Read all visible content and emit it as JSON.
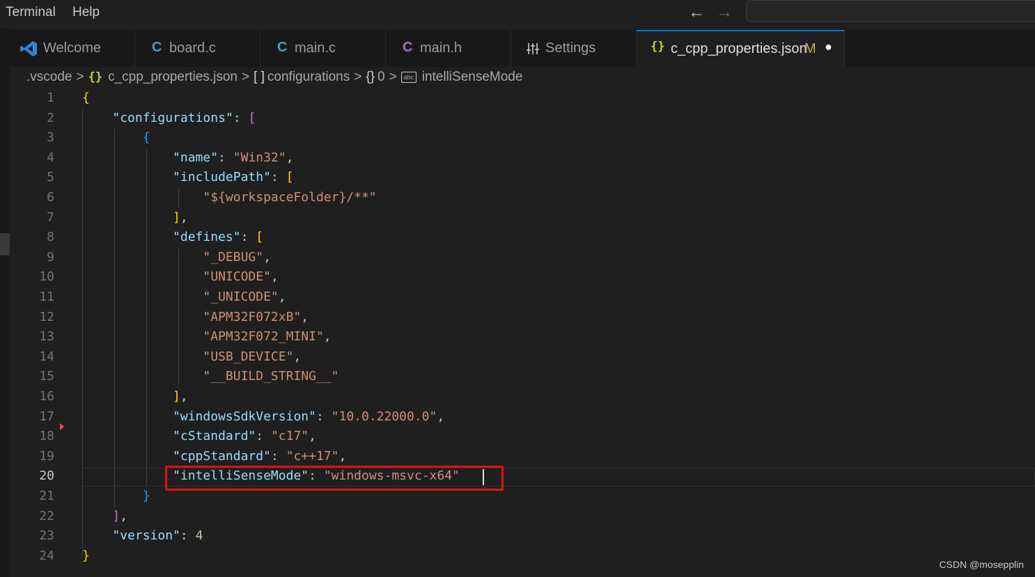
{
  "menu": {
    "terminal": "Terminal",
    "help": "Help"
  },
  "nav": {
    "back": "←",
    "forward": "→"
  },
  "tabs": [
    {
      "icon": "vscode-icon",
      "glyph": "",
      "label": "Welcome",
      "color": "#2f87d8"
    },
    {
      "icon": "c-file-icon",
      "glyph": "C",
      "label": "board.c",
      "color": "#519aba"
    },
    {
      "icon": "c-file-icon",
      "glyph": "C",
      "label": "main.c",
      "color": "#519aba"
    },
    {
      "icon": "h-file-icon",
      "glyph": "C",
      "label": "main.h",
      "color": "#a074c4"
    },
    {
      "icon": "settings-icon",
      "glyph": "",
      "label": "Settings",
      "color": "#cccccc"
    },
    {
      "icon": "json-icon",
      "glyph": "{}",
      "label": "c_cpp_properties.json",
      "modified": "M",
      "dirty": "●",
      "color": "#cbcb41"
    }
  ],
  "breadcrumb": {
    "folder": ".vscode",
    "file_icon": "{}",
    "file": "c_cpp_properties.json",
    "array_icon": "[ ]",
    "array": "configurations",
    "object_icon": "{}",
    "index": "0",
    "leaf_icon": "abc",
    "leaf": "intelliSenseMode",
    "sep": ">"
  },
  "editor": {
    "current_line": 20,
    "line_numbers": [
      "1",
      "2",
      "3",
      "4",
      "5",
      "6",
      "7",
      "8",
      "9",
      "10",
      "11",
      "12",
      "13",
      "14",
      "15",
      "16",
      "17",
      "18",
      "19",
      "20",
      "21",
      "22",
      "23",
      "24"
    ],
    "lines": [
      [
        [
          "b1",
          "{"
        ]
      ],
      [
        [
          "p",
          "    "
        ],
        [
          "k",
          "\"configurations\""
        ],
        [
          "p",
          ": "
        ],
        [
          "b2",
          "["
        ]
      ],
      [
        [
          "p",
          "        "
        ],
        [
          "b3",
          "{"
        ]
      ],
      [
        [
          "p",
          "            "
        ],
        [
          "k",
          "\"name\""
        ],
        [
          "p",
          ": "
        ],
        [
          "s",
          "\"Win32\""
        ],
        [
          "p",
          ","
        ]
      ],
      [
        [
          "p",
          "            "
        ],
        [
          "k",
          "\"includePath\""
        ],
        [
          "p",
          ": "
        ],
        [
          "b1",
          "["
        ]
      ],
      [
        [
          "p",
          "                "
        ],
        [
          "s",
          "\"${workspaceFolder}/**\""
        ]
      ],
      [
        [
          "p",
          "            "
        ],
        [
          "b1",
          "]"
        ],
        [
          "p",
          ","
        ]
      ],
      [
        [
          "p",
          "            "
        ],
        [
          "k",
          "\"defines\""
        ],
        [
          "p",
          ": "
        ],
        [
          "b1",
          "["
        ]
      ],
      [
        [
          "p",
          "                "
        ],
        [
          "s",
          "\"_DEBUG\""
        ],
        [
          "p",
          ","
        ]
      ],
      [
        [
          "p",
          "                "
        ],
        [
          "s",
          "\"UNICODE\""
        ],
        [
          "p",
          ","
        ]
      ],
      [
        [
          "p",
          "                "
        ],
        [
          "s",
          "\"_UNICODE\""
        ],
        [
          "p",
          ","
        ]
      ],
      [
        [
          "p",
          "                "
        ],
        [
          "s",
          "\"APM32F072xB\""
        ],
        [
          "p",
          ","
        ]
      ],
      [
        [
          "p",
          "                "
        ],
        [
          "s",
          "\"APM32F072_MINI\""
        ],
        [
          "p",
          ","
        ]
      ],
      [
        [
          "p",
          "                "
        ],
        [
          "s",
          "\"USB_DEVICE\""
        ],
        [
          "p",
          ","
        ]
      ],
      [
        [
          "p",
          "                "
        ],
        [
          "s",
          "\"__BUILD_STRING__\""
        ]
      ],
      [
        [
          "p",
          "            "
        ],
        [
          "b1",
          "]"
        ],
        [
          "p",
          ","
        ]
      ],
      [
        [
          "p",
          "            "
        ],
        [
          "k",
          "\"windowsSdkVersion\""
        ],
        [
          "p",
          ": "
        ],
        [
          "s",
          "\"10.0.22000.0\""
        ],
        [
          "p",
          ","
        ]
      ],
      [
        [
          "p",
          "            "
        ],
        [
          "k",
          "\"cStandard\""
        ],
        [
          "p",
          ": "
        ],
        [
          "s",
          "\"c17\""
        ],
        [
          "p",
          ","
        ]
      ],
      [
        [
          "p",
          "            "
        ],
        [
          "k",
          "\"cppStandard\""
        ],
        [
          "p",
          ": "
        ],
        [
          "s",
          "\"c++17\""
        ],
        [
          "p",
          ","
        ]
      ],
      [
        [
          "p",
          "            "
        ],
        [
          "k",
          "\"intelliSenseMode\""
        ],
        [
          "p",
          ": "
        ],
        [
          "s",
          "\"windows-msvc-x64\""
        ]
      ],
      [
        [
          "p",
          "        "
        ],
        [
          "b3",
          "}"
        ]
      ],
      [
        [
          "p",
          "    "
        ],
        [
          "b2",
          "]"
        ],
        [
          "p",
          ","
        ]
      ],
      [
        [
          "p",
          "    "
        ],
        [
          "k",
          "\"version\""
        ],
        [
          "p",
          ": "
        ],
        [
          "n",
          "4"
        ]
      ],
      [
        [
          "b1",
          "}"
        ]
      ]
    ]
  },
  "watermark": "CSDN @mosepplin"
}
